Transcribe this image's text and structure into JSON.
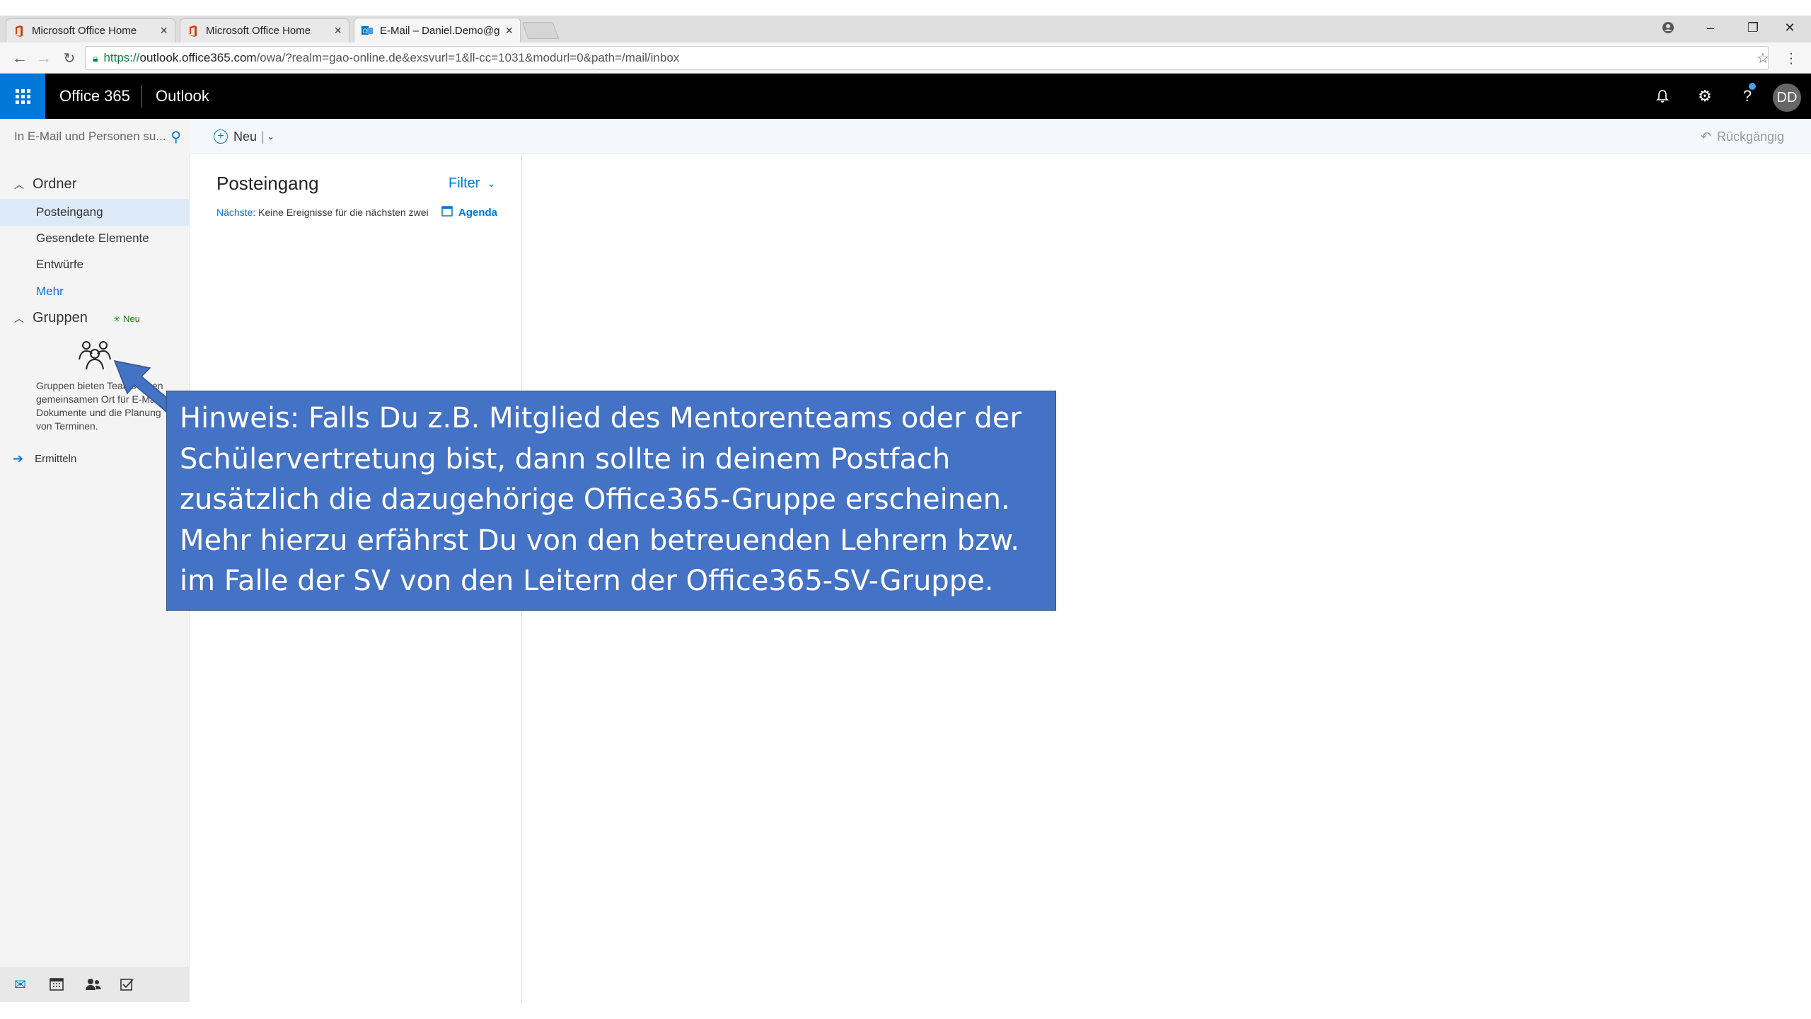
{
  "browser": {
    "tabs": [
      {
        "title": "Microsoft Office Home",
        "active": false,
        "favicon": "office-icon"
      },
      {
        "title": "Microsoft Office Home",
        "active": false,
        "favicon": "office-icon"
      },
      {
        "title": "E-Mail – Daniel.Demo@g",
        "active": true,
        "favicon": "outlook-icon"
      }
    ],
    "url_prefix": "https://",
    "url_host": "outlook.office365.com",
    "url_path": "/owa/?realm=gao-online.de&exsvurl=1&ll-cc=1031&modurl=0&path=/mail/inbox"
  },
  "header": {
    "brand": "Office 365",
    "app": "Outlook",
    "avatar_initials": "DD"
  },
  "search": {
    "placeholder": "In E-Mail und Personen su..."
  },
  "toolbar": {
    "new_label": "Neu",
    "undo_label": "Rückgängig"
  },
  "sidebar": {
    "folders_heading": "Ordner",
    "items": [
      {
        "label": "Posteingang",
        "selected": true
      },
      {
        "label": "Gesendete Elemente",
        "selected": false
      },
      {
        "label": "Entwürfe",
        "selected": false
      }
    ],
    "more_label": "Mehr",
    "groups_heading": "Gruppen",
    "groups_new_badge": "Neu",
    "groups_description": "Gruppen bieten Teams einen gemeinsamen Ort für E-Mails, Dokumente und die Planung von Terminen.",
    "discover_label": "Ermitteln"
  },
  "message_list": {
    "title": "Posteingang",
    "filter_label": "Filter",
    "next_label": "Nächste:",
    "next_text": "Keine Ereignisse für die nächsten zwei Tage.",
    "agenda_label": "Agenda"
  },
  "callout": {
    "lines": [
      "Hinweis: Falls Du z.B. Mitglied des Mentorenteams oder der",
      "Schülervertretung bist, dann sollte in deinem Postfach",
      "zusätzlich die dazugehörige Office365-Gruppe erscheinen.",
      "Mehr hierzu erfährst Du von den betreuenden Lehrern bzw.",
      "im Falle der SV von den Leitern der Office365-SV-Gruppe."
    ]
  },
  "colors": {
    "accent": "#0078d7",
    "callout_bg": "#4472c4",
    "header_bg": "#000000"
  }
}
